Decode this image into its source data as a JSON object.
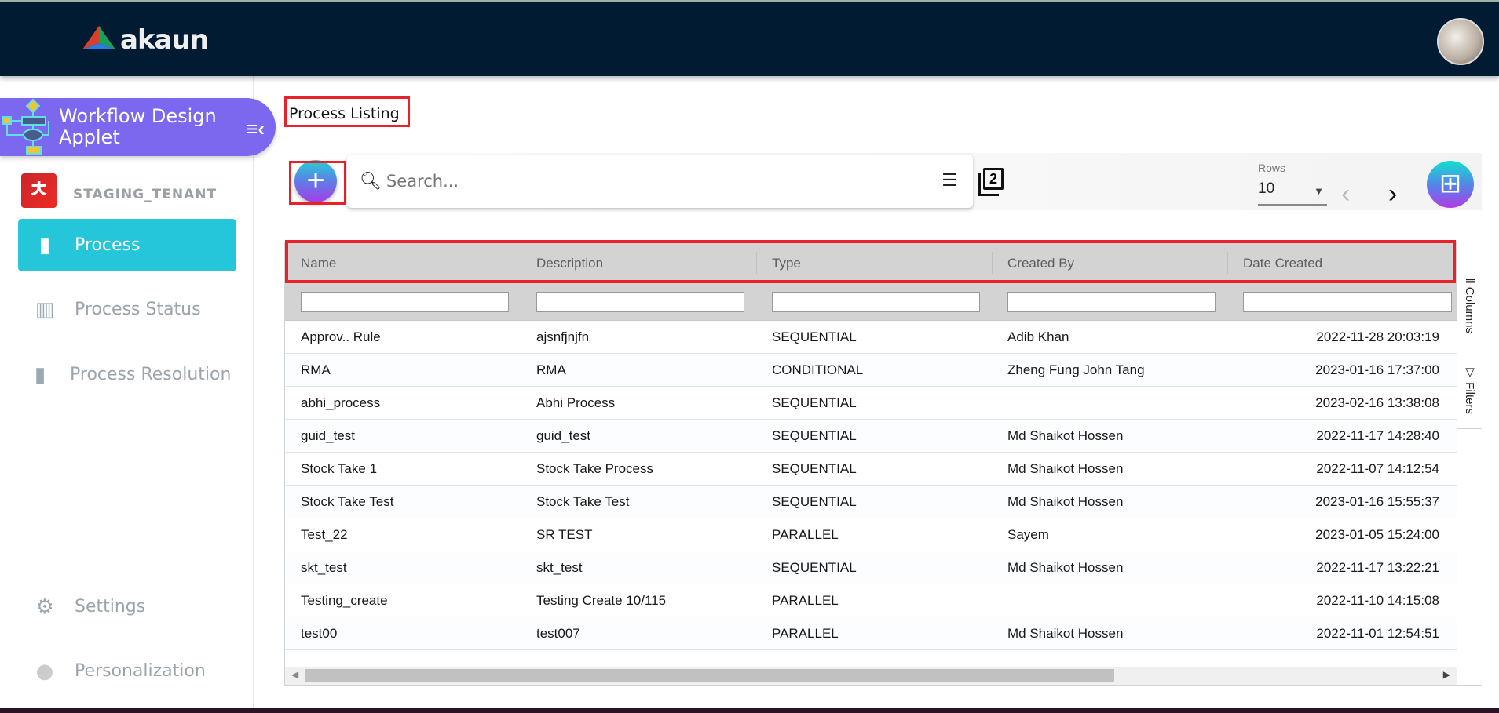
{
  "header": {
    "brand": "akaun"
  },
  "sidebar": {
    "applet_title": "Workflow Design Applet",
    "tenant": "STAGING_TENANT",
    "items": [
      {
        "label": "Process",
        "icon": "file-icon",
        "active": true
      },
      {
        "label": "Process Status",
        "icon": "bar-chart-icon"
      },
      {
        "label": "Process Resolution",
        "icon": "file-icon"
      }
    ],
    "bottom_items": [
      {
        "label": "Settings",
        "icon": "gear-icon"
      },
      {
        "label": "Personalization",
        "icon": "user-icon"
      }
    ]
  },
  "main": {
    "title": "Process Listing",
    "search": {
      "placeholder": "Search...",
      "value": ""
    },
    "rows_label": "Rows",
    "rows_value": "10",
    "copy_badge": "2"
  },
  "table": {
    "columns": [
      "Name",
      "Description",
      "Type",
      "Created By",
      "Date Created"
    ],
    "rows": [
      [
        "Approv.. Rule",
        "ajsnfjnjfn",
        "SEQUENTIAL",
        "Adib Khan",
        "2022-11-28 20:03:19"
      ],
      [
        "RMA",
        "RMA",
        "CONDITIONAL",
        "Zheng Fung John Tang",
        "2023-01-16 17:37:00"
      ],
      [
        "abhi_process",
        "Abhi Process",
        "SEQUENTIAL",
        "",
        "2023-02-16 13:38:08"
      ],
      [
        "guid_test",
        "guid_test",
        "SEQUENTIAL",
        "Md Shaikot Hossen",
        "2022-11-17 14:28:40"
      ],
      [
        "Stock Take 1",
        "Stock Take Process",
        "SEQUENTIAL",
        "Md Shaikot Hossen",
        "2022-11-07 14:12:54"
      ],
      [
        "Stock Take Test",
        "Stock Take Test",
        "SEQUENTIAL",
        "Md Shaikot Hossen",
        "2023-01-16 15:55:37"
      ],
      [
        "Test_22",
        "SR TEST",
        "PARALLEL",
        "Sayem",
        "2023-01-05 15:24:00"
      ],
      [
        "skt_test",
        "skt_test",
        "SEQUENTIAL",
        "Md Shaikot Hossen",
        "2022-11-17 13:22:21"
      ],
      [
        "Testing_create",
        "Testing Create 10/115",
        "PARALLEL",
        "",
        "2022-11-10 14:15:08"
      ],
      [
        "test00",
        "test007",
        "PARALLEL",
        "Md Shaikot Hossen",
        "2022-11-01 12:54:51"
      ]
    ],
    "side_tabs": [
      "Columns",
      "Filters"
    ]
  },
  "colors": {
    "header": "#011b33",
    "applet": "#7b68ee",
    "active": "#26c6da",
    "highlight": "#e8212b"
  }
}
